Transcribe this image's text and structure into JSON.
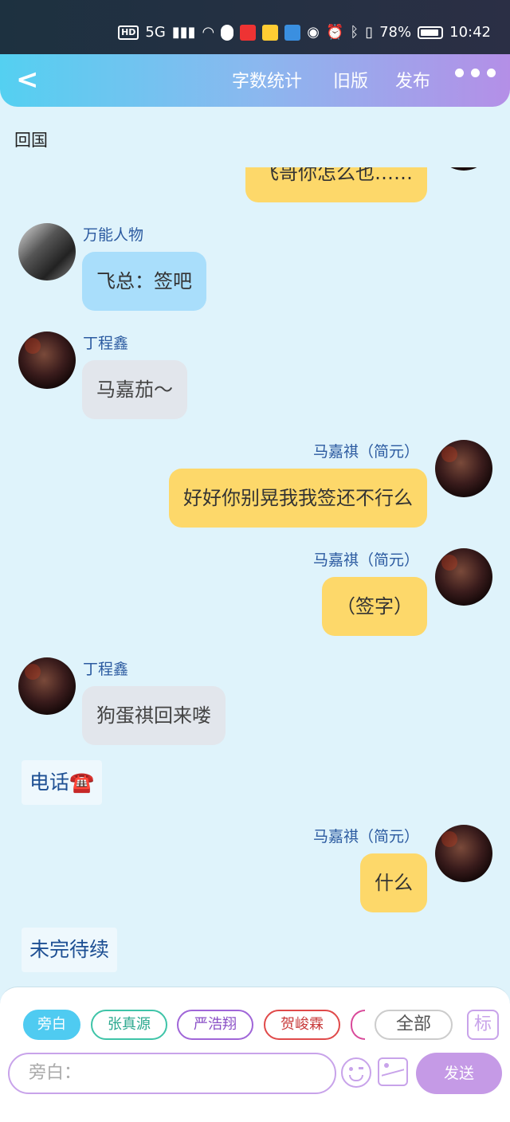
{
  "status": {
    "network": "5G",
    "hd": "HD",
    "battery": "78%",
    "time": "10:42"
  },
  "header": {
    "back_icon": "chevron-left-icon",
    "word_count": "字数统计",
    "old_version": "旧版",
    "publish": "发布"
  },
  "chapter_title": "回国",
  "messages": [
    {
      "side": "right",
      "text": "飞哥你怎么也……",
      "color": "yellow"
    },
    {
      "side": "left",
      "name": "万能人物",
      "text": "飞总：签吧",
      "color": "blue"
    },
    {
      "side": "left",
      "name": "丁程鑫",
      "text": "马嘉茄～",
      "color": "grey"
    },
    {
      "side": "right",
      "name": "马嘉祺（简元）",
      "text": "好好你别晃我我签还不行么",
      "color": "yellow"
    },
    {
      "side": "right",
      "name": "马嘉祺（简元）",
      "text": "（签字）",
      "color": "yellow"
    },
    {
      "side": "left",
      "name": "丁程鑫",
      "text": "狗蛋祺回来喽",
      "color": "grey"
    },
    {
      "side": "narration",
      "text": "电话☎️"
    },
    {
      "side": "right",
      "name": "马嘉祺（简元）",
      "text": "什么",
      "color": "yellow"
    },
    {
      "side": "narration",
      "text": "未完待续"
    }
  ],
  "chips": [
    "旁白",
    "张真源",
    "严浩翔",
    "贺峻霖",
    "全部"
  ],
  "chip_colors": [
    "#4fcbf1",
    "#3fc4a8",
    "#a066d8",
    "#e04a4a",
    "#d94a9a",
    "#cccccc"
  ],
  "mark_label": "标",
  "input_placeholder": "旁白：",
  "send_label": "发送"
}
